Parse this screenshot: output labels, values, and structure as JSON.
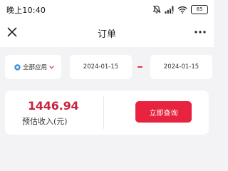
{
  "status_bar": {
    "time": "晚上10:40",
    "icons": [
      "mute-icon",
      "signal-icon",
      "wifi-icon",
      "battery-icon"
    ],
    "battery_level": "65"
  },
  "nav": {
    "title": "订单",
    "left_icon": "close-icon",
    "right_icon": "more-icon"
  },
  "filter": {
    "app_select": "全部应用",
    "start_date": "2024-01-15",
    "end_date": "2024-01-15"
  },
  "summary": {
    "amount": "1446.94",
    "label": "预估收入(元)",
    "button": "立即查询"
  },
  "colors": {
    "accent": "#e8233f",
    "amount": "#c8233f",
    "background": "#f3f3f5",
    "card": "#ffffff"
  }
}
